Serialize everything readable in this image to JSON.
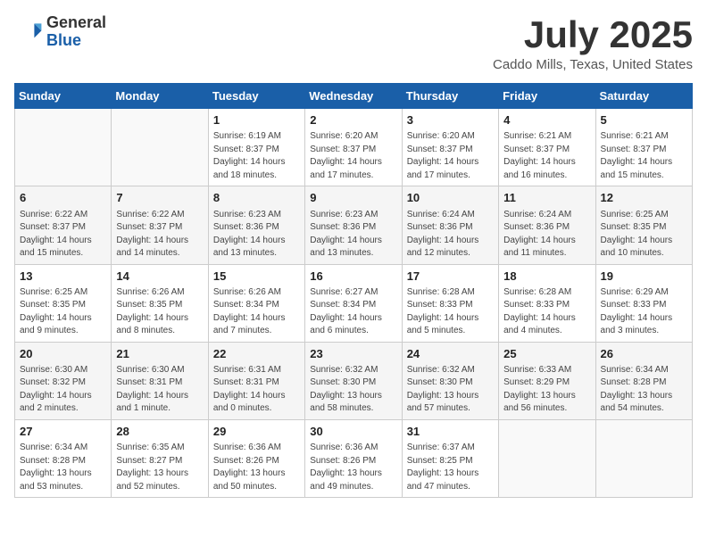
{
  "header": {
    "logo_general": "General",
    "logo_blue": "Blue",
    "month_year": "July 2025",
    "location": "Caddo Mills, Texas, United States"
  },
  "days_of_week": [
    "Sunday",
    "Monday",
    "Tuesday",
    "Wednesday",
    "Thursday",
    "Friday",
    "Saturday"
  ],
  "weeks": [
    [
      {
        "day": "",
        "info": ""
      },
      {
        "day": "",
        "info": ""
      },
      {
        "day": "1",
        "info": "Sunrise: 6:19 AM\nSunset: 8:37 PM\nDaylight: 14 hours and 18 minutes."
      },
      {
        "day": "2",
        "info": "Sunrise: 6:20 AM\nSunset: 8:37 PM\nDaylight: 14 hours and 17 minutes."
      },
      {
        "day": "3",
        "info": "Sunrise: 6:20 AM\nSunset: 8:37 PM\nDaylight: 14 hours and 17 minutes."
      },
      {
        "day": "4",
        "info": "Sunrise: 6:21 AM\nSunset: 8:37 PM\nDaylight: 14 hours and 16 minutes."
      },
      {
        "day": "5",
        "info": "Sunrise: 6:21 AM\nSunset: 8:37 PM\nDaylight: 14 hours and 15 minutes."
      }
    ],
    [
      {
        "day": "6",
        "info": "Sunrise: 6:22 AM\nSunset: 8:37 PM\nDaylight: 14 hours and 15 minutes."
      },
      {
        "day": "7",
        "info": "Sunrise: 6:22 AM\nSunset: 8:37 PM\nDaylight: 14 hours and 14 minutes."
      },
      {
        "day": "8",
        "info": "Sunrise: 6:23 AM\nSunset: 8:36 PM\nDaylight: 14 hours and 13 minutes."
      },
      {
        "day": "9",
        "info": "Sunrise: 6:23 AM\nSunset: 8:36 PM\nDaylight: 14 hours and 13 minutes."
      },
      {
        "day": "10",
        "info": "Sunrise: 6:24 AM\nSunset: 8:36 PM\nDaylight: 14 hours and 12 minutes."
      },
      {
        "day": "11",
        "info": "Sunrise: 6:24 AM\nSunset: 8:36 PM\nDaylight: 14 hours and 11 minutes."
      },
      {
        "day": "12",
        "info": "Sunrise: 6:25 AM\nSunset: 8:35 PM\nDaylight: 14 hours and 10 minutes."
      }
    ],
    [
      {
        "day": "13",
        "info": "Sunrise: 6:25 AM\nSunset: 8:35 PM\nDaylight: 14 hours and 9 minutes."
      },
      {
        "day": "14",
        "info": "Sunrise: 6:26 AM\nSunset: 8:35 PM\nDaylight: 14 hours and 8 minutes."
      },
      {
        "day": "15",
        "info": "Sunrise: 6:26 AM\nSunset: 8:34 PM\nDaylight: 14 hours and 7 minutes."
      },
      {
        "day": "16",
        "info": "Sunrise: 6:27 AM\nSunset: 8:34 PM\nDaylight: 14 hours and 6 minutes."
      },
      {
        "day": "17",
        "info": "Sunrise: 6:28 AM\nSunset: 8:33 PM\nDaylight: 14 hours and 5 minutes."
      },
      {
        "day": "18",
        "info": "Sunrise: 6:28 AM\nSunset: 8:33 PM\nDaylight: 14 hours and 4 minutes."
      },
      {
        "day": "19",
        "info": "Sunrise: 6:29 AM\nSunset: 8:33 PM\nDaylight: 14 hours and 3 minutes."
      }
    ],
    [
      {
        "day": "20",
        "info": "Sunrise: 6:30 AM\nSunset: 8:32 PM\nDaylight: 14 hours and 2 minutes."
      },
      {
        "day": "21",
        "info": "Sunrise: 6:30 AM\nSunset: 8:31 PM\nDaylight: 14 hours and 1 minute."
      },
      {
        "day": "22",
        "info": "Sunrise: 6:31 AM\nSunset: 8:31 PM\nDaylight: 14 hours and 0 minutes."
      },
      {
        "day": "23",
        "info": "Sunrise: 6:32 AM\nSunset: 8:30 PM\nDaylight: 13 hours and 58 minutes."
      },
      {
        "day": "24",
        "info": "Sunrise: 6:32 AM\nSunset: 8:30 PM\nDaylight: 13 hours and 57 minutes."
      },
      {
        "day": "25",
        "info": "Sunrise: 6:33 AM\nSunset: 8:29 PM\nDaylight: 13 hours and 56 minutes."
      },
      {
        "day": "26",
        "info": "Sunrise: 6:34 AM\nSunset: 8:28 PM\nDaylight: 13 hours and 54 minutes."
      }
    ],
    [
      {
        "day": "27",
        "info": "Sunrise: 6:34 AM\nSunset: 8:28 PM\nDaylight: 13 hours and 53 minutes."
      },
      {
        "day": "28",
        "info": "Sunrise: 6:35 AM\nSunset: 8:27 PM\nDaylight: 13 hours and 52 minutes."
      },
      {
        "day": "29",
        "info": "Sunrise: 6:36 AM\nSunset: 8:26 PM\nDaylight: 13 hours and 50 minutes."
      },
      {
        "day": "30",
        "info": "Sunrise: 6:36 AM\nSunset: 8:26 PM\nDaylight: 13 hours and 49 minutes."
      },
      {
        "day": "31",
        "info": "Sunrise: 6:37 AM\nSunset: 8:25 PM\nDaylight: 13 hours and 47 minutes."
      },
      {
        "day": "",
        "info": ""
      },
      {
        "day": "",
        "info": ""
      }
    ]
  ]
}
